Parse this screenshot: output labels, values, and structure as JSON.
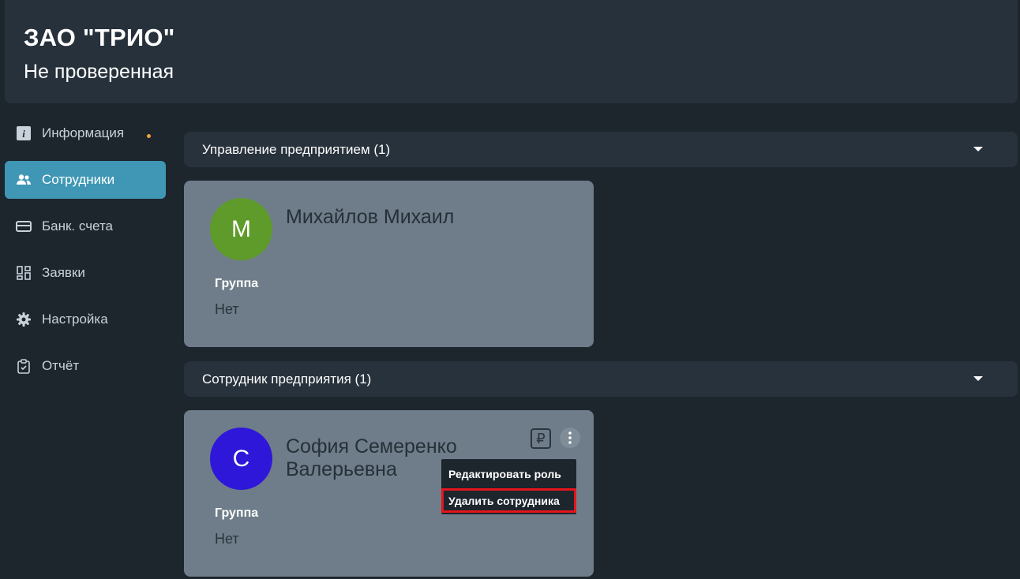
{
  "header": {
    "org_name": "ЗАО \"ТРИО\"",
    "status": "Не проверенная"
  },
  "sidebar": {
    "items": [
      {
        "label": "Информация",
        "icon": "info-icon",
        "has_dot": true
      },
      {
        "label": "Сотрудники",
        "icon": "people-icon",
        "active": true
      },
      {
        "label": "Банк. счета",
        "icon": "card-icon"
      },
      {
        "label": "Заявки",
        "icon": "grid-icon"
      },
      {
        "label": "Настройка",
        "icon": "gear-icon"
      },
      {
        "label": "Отчёт",
        "icon": "clipboard-icon"
      }
    ]
  },
  "sections": [
    {
      "title": "Управление предприятием (1)",
      "employee": {
        "avatar_letter": "М",
        "avatar_color": "#5e9b2a",
        "name": "Михайлов Михаил",
        "group_label": "Группа",
        "group_value": "Нет"
      }
    },
    {
      "title": "Сотрудник предприятия (1)",
      "employee": {
        "avatar_letter": "С",
        "avatar_color": "#2e17d9",
        "name": "София Семеренко Валерьевна",
        "group_label": "Группа",
        "group_value": "Нет",
        "ruble_symbol": "₽"
      }
    }
  ],
  "context_menu": {
    "items": [
      "Редактировать роль",
      "Удалить сотрудника"
    ]
  },
  "colors": {
    "accent": "#3f97b5",
    "highlight": "#e6141b",
    "notification_dot": "#f2a33a"
  }
}
